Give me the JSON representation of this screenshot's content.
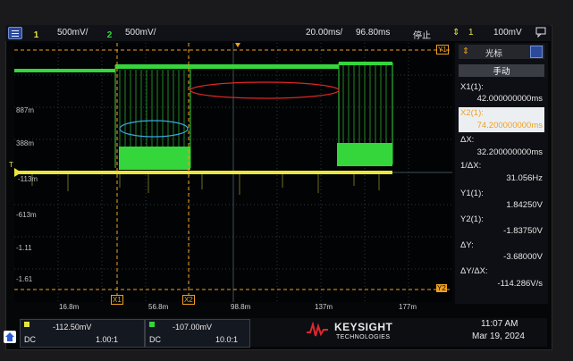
{
  "topbar": {
    "ch1_num": "1",
    "ch1_scale": "500mV/",
    "ch2_num": "2",
    "ch2_scale": "500mV/",
    "timebase": "20.00ms/",
    "delay": "96.80ms",
    "run_state": "停止",
    "trig_num": "1",
    "trig_level": "100mV"
  },
  "plot": {
    "y_ticks": [
      "887m",
      "388m",
      "-113m",
      "-613m",
      "-1.11",
      "-1.61"
    ],
    "x_ticks": [
      "16.8m",
      "56.8m",
      "98.8m",
      "137m",
      "177m"
    ],
    "markers": {
      "x1": "X1",
      "x2": "X2",
      "y1": "Y1",
      "y2": "Y2",
      "trig": "T"
    }
  },
  "cursor_panel": {
    "header": "光标",
    "mode": "手动",
    "x1_label": "X1(1):",
    "x1_value": "42.000000000ms",
    "x2_label": "X2(1):",
    "x2_value": "74.200000000ms",
    "dx_label": "ΔX:",
    "dx_value": "32.200000000ms",
    "inv_dx_label": "1/ΔX:",
    "inv_dx_value": "31.056Hz",
    "y1_label": "Y1(1):",
    "y1_value": "1.84250V",
    "y2_label": "Y2(1):",
    "y2_value": "-1.83750V",
    "dy_label": "ΔY:",
    "dy_value": "-3.68000V",
    "dydx_label": "ΔY/ΔX:",
    "dydx_value": "-114.286V/s"
  },
  "bottom": {
    "ch1_offset": "-112.50mV",
    "ch1_coupling": "DC",
    "ch1_probe": "1.00:1",
    "ch2_offset": "-107.00mV",
    "ch2_coupling": "DC",
    "ch2_probe": "10.0:1",
    "brand": "KEYSIGHT",
    "brand_sub": "TECHNOLOGIES",
    "time": "11:07 AM",
    "date": "Mar 19, 2024"
  },
  "colors": {
    "ch1": "#e8e63a",
    "ch2": "#35d63c",
    "cursor": "#f0a020",
    "accent": "#2f5bd0"
  }
}
